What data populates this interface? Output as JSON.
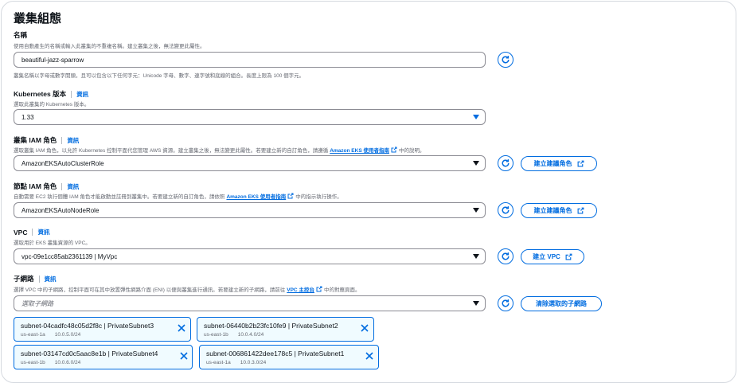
{
  "section_title": "叢集組態",
  "info_link": "資訊",
  "name": {
    "label": "名稱",
    "desc": "使用自動產生的名稱或輸入此叢集的不重複名稱。建立叢集之後，無法變更此屬性。",
    "value": "beautiful-jazz-sparrow",
    "hint": "叢集名稱以字母或數字開頭，且可以包含以下任何字元：Unicode 字母、數字、連字號和底線的組合。長度上限為 100 個字元。"
  },
  "kubernetes": {
    "label": "Kubernetes 版本",
    "desc": "選取此叢集的 Kubernetes 版本。",
    "value": "1.33"
  },
  "cluster_role": {
    "label": "叢集 IAM 角色",
    "desc": "選取叢集 IAM 角色，以允許 Kubernetes 控制平面代您管理 AWS 資源。建立叢集之後，無法變更此屬性。若要建立新的自訂角色，請遵循",
    "link": "Amazon EKS 使用者指南",
    "desc_end": "中的說明。",
    "value": "AmazonEKSAutoClusterRole",
    "button": "建立建議角色"
  },
  "node_role": {
    "label": "節點 IAM 角色",
    "desc": "自動需要 EC2 執行個體 IAM 角色才能啟動並註冊到叢集中。若要建立新的自訂角色，請依照",
    "link": "Amazon EKS 使用者指南",
    "desc_end": "中的指示執行操作。",
    "value": "AmazonEKSAutoNodeRole",
    "button": "建立建議角色"
  },
  "vpc": {
    "label": "VPC",
    "desc": "選取用於 EKS 叢集資源的 VPC。",
    "value": "vpc-09e1cc85ab2361139 | MyVpc",
    "button": "建立 VPC"
  },
  "subnets": {
    "label": "子網路",
    "desc": "選擇 VPC 中的子網路，控制平面可在其中放置彈性網路介面 (ENI) 以便與叢集進行通訊。若要建立新的子網路，請前往",
    "link": "VPC 主控台",
    "desc_end": "中的對應頁面。",
    "placeholder": "選取子網路",
    "button": "清除選取的子網路",
    "tokens": [
      {
        "name": "subnet-04cadfc48c05d2f8c | PrivateSubnet3",
        "az": "us-east-1a",
        "cidr": "10.0.5.0/24"
      },
      {
        "name": "subnet-06440b2b23fc10fe9 | PrivateSubnet2",
        "az": "us-east-1b",
        "cidr": "10.0.4.0/24"
      },
      {
        "name": "subnet-03147cd0c5aac8e1b | PrivateSubnet4",
        "az": "us-east-1b",
        "cidr": "10.0.6.0/24"
      },
      {
        "name": "subnet-006861422dee178c5 | PrivateSubnet1",
        "az": "us-east-1a",
        "cidr": "10.0.3.0/24"
      }
    ]
  },
  "colors": {
    "accent": "#006ce0",
    "text": "#0f141a",
    "muted": "#656871",
    "border": "#8c8c94"
  }
}
